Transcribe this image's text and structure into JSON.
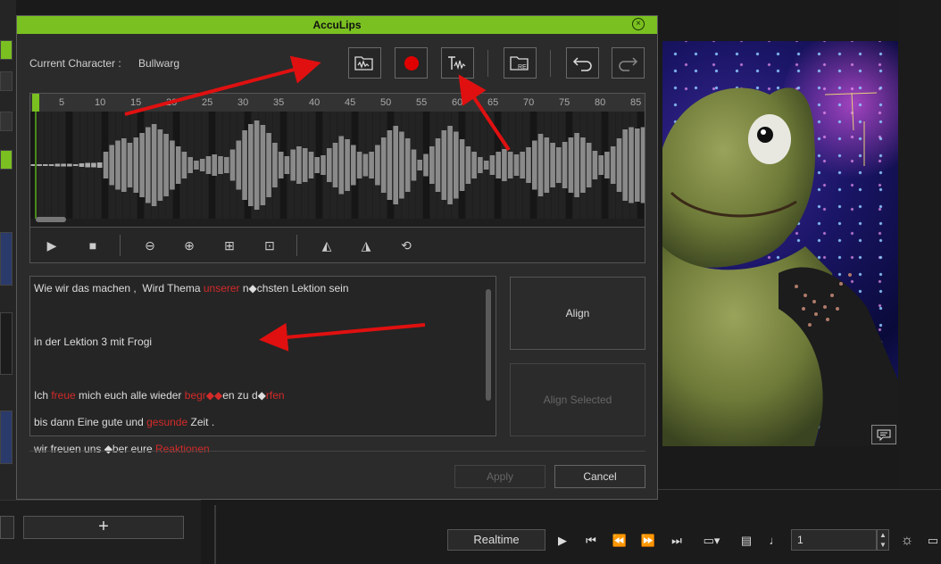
{
  "dialog": {
    "title": "AccuLips",
    "current_character_label": "Current Character :",
    "current_character_value": "Bullwarg",
    "toolbar": {
      "import_audio": "folder-audio-icon",
      "record": "record-icon",
      "text_to_wave": "text-wave-icon",
      "import_rei": "folder-rei-icon",
      "rei_label": "REI",
      "undo": "undo-icon",
      "redo": "redo-icon",
      "record_color": "#e00000"
    },
    "timeline": {
      "ticks": [
        "5",
        "10",
        "15",
        "20",
        "25",
        "30",
        "35",
        "40",
        "45",
        "50",
        "55",
        "60",
        "65",
        "70",
        "75",
        "80",
        "85"
      ],
      "waveform": [
        0.02,
        0.02,
        0.02,
        0.02,
        0.03,
        0.03,
        0.03,
        0.02,
        0.04,
        0.05,
        0.05,
        0.06,
        0.3,
        0.45,
        0.55,
        0.6,
        0.5,
        0.62,
        0.72,
        0.85,
        0.92,
        0.8,
        0.7,
        0.55,
        0.42,
        0.3,
        0.18,
        0.1,
        0.14,
        0.2,
        0.24,
        0.2,
        0.18,
        0.35,
        0.55,
        0.78,
        0.92,
        1.0,
        0.9,
        0.72,
        0.5,
        0.3,
        0.2,
        0.35,
        0.42,
        0.38,
        0.3,
        0.18,
        0.22,
        0.38,
        0.5,
        0.65,
        0.58,
        0.45,
        0.3,
        0.25,
        0.3,
        0.45,
        0.62,
        0.78,
        0.88,
        0.75,
        0.6,
        0.35,
        0.12,
        0.25,
        0.42,
        0.6,
        0.78,
        0.88,
        0.75,
        0.58,
        0.42,
        0.3,
        0.18,
        0.1,
        0.22,
        0.3,
        0.36,
        0.3,
        0.24,
        0.3,
        0.4,
        0.55,
        0.7,
        0.62,
        0.5,
        0.4,
        0.52,
        0.62,
        0.72,
        0.62,
        0.5,
        0.32,
        0.22,
        0.3,
        0.42,
        0.6,
        0.8,
        0.85,
        0.82,
        0.85
      ],
      "wave_color": "#8a8a8a",
      "playhead_color": "#7ac021"
    },
    "controls": [
      "play-icon",
      "stop-icon",
      "zoom-out-icon",
      "zoom-in-icon",
      "zoom-selection-icon",
      "zoom-fit-icon",
      "prev-mark-icon",
      "next-mark-icon",
      "loop-icon"
    ],
    "text_lines": [
      [
        {
          "t": "Wie wir das machen ,  Wird Thema "
        },
        {
          "t": "unserer",
          "red": true
        },
        {
          "t": " n◆chsten Lektion sein"
        }
      ],
      [],
      [
        {
          "t": "in der Lektion 3 mit Frogi"
        }
      ],
      [],
      [
        {
          "t": "Ich "
        },
        {
          "t": "freue",
          "red": true
        },
        {
          "t": " mich euch alle wieder "
        },
        {
          "t": "begr◆◆",
          "red": true
        },
        {
          "t": "en zu d"
        },
        {
          "t": "◆",
          "red": false
        },
        {
          "t": "rfen",
          "red": true
        }
      ],
      [
        {
          "t": "bis dann Eine gute und "
        },
        {
          "t": "gesunde",
          "red": true
        },
        {
          "t": " Zeit ."
        }
      ],
      [
        {
          "t": "wir freuen uns ◆ber eure "
        },
        {
          "t": "Reaktionen",
          "red": true
        }
      ]
    ],
    "align_label": "Align",
    "align_selected_label": "Align Selected",
    "apply_label": "Apply",
    "cancel_label": "Cancel"
  },
  "bottom_toolbar": {
    "realtime_label": "Realtime",
    "frame_value": "1",
    "icons": [
      "play-icon",
      "go-start-icon",
      "step-back-icon",
      "step-forward-icon",
      "go-end-icon",
      "screen-icon",
      "comment-icon",
      "music-note-icon"
    ]
  },
  "accent": "#7ac021"
}
